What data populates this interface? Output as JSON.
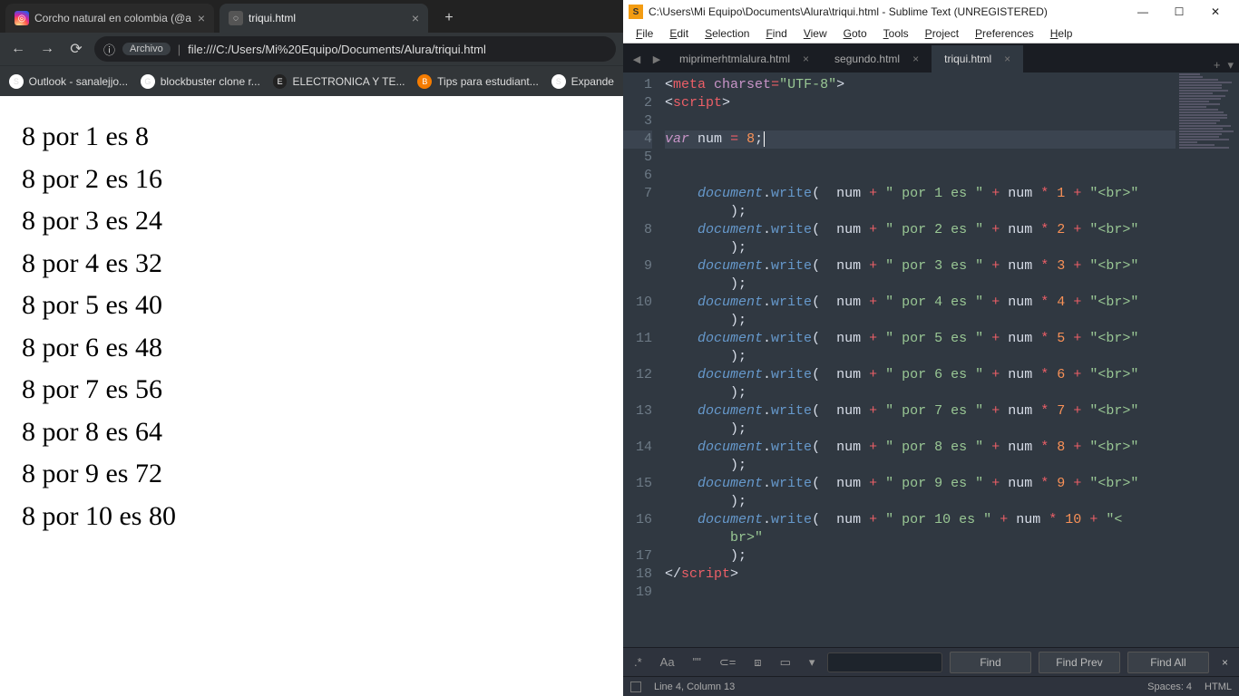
{
  "browser": {
    "tabs": [
      {
        "title": "Corcho natural en colombia (@a",
        "favicon": "ig"
      },
      {
        "title": "triqui.html",
        "favicon": "file"
      }
    ],
    "new_tab": "+",
    "nav": {
      "back": "←",
      "fwd": "→",
      "reload": "⟳",
      "chip_icon": "ⓘ",
      "chip_label": "Archivo",
      "url": "file:///C:/Users/Mi%20Equipo/Documents/Alura/triqui.html"
    },
    "bookmarks": [
      {
        "icon": "S",
        "label": "Outlook - sanalejjo..."
      },
      {
        "icon": "G",
        "label": "blockbuster clone r..."
      },
      {
        "icon": "E",
        "label": "ELECTRONICA Y TE..."
      },
      {
        "icon": "B",
        "label": "Tips para estudiant..."
      },
      {
        "icon": "S",
        "label": "Expande"
      }
    ],
    "page_lines": [
      "8 por 1 es 8",
      "8 por 2 es 16",
      "8 por 3 es 24",
      "8 por 4 es 32",
      "8 por 5 es 40",
      "8 por 6 es 48",
      "8 por 7 es 56",
      "8 por 8 es 64",
      "8 por 9 es 72",
      "8 por 10 es 80"
    ]
  },
  "sublime": {
    "title": "C:\\Users\\Mi Equipo\\Documents\\Alura\\triqui.html - Sublime Text (UNREGISTERED)",
    "win_btns": {
      "min": "—",
      "max": "☐",
      "close": "✕"
    },
    "menu": [
      "File",
      "Edit",
      "Selection",
      "Find",
      "View",
      "Goto",
      "Tools",
      "Project",
      "Preferences",
      "Help"
    ],
    "file_tabs": [
      "miprimerhtmlalura.html",
      "segundo.html",
      "triqui.html"
    ],
    "active_tab": 2,
    "gutter": [
      "1",
      "2",
      "3",
      "4",
      "5",
      "6",
      "7",
      "",
      "8",
      "",
      "9",
      "",
      "10",
      "",
      "11",
      "",
      "12",
      "",
      "13",
      "",
      "14",
      "",
      "15",
      "",
      "16",
      "",
      "17",
      "18",
      "19"
    ],
    "find": {
      "modes": [
        ".*",
        "Aa",
        "\"\"",
        "⊂=",
        "⧈",
        "▭"
      ],
      "btn_find": "Find",
      "btn_prev": "Find Prev",
      "btn_all": "Find All"
    },
    "status": {
      "pos": "Line 4, Column 13",
      "spaces": "Spaces: 4",
      "lang": "HTML"
    }
  },
  "code": {
    "num_var": "8",
    "lines": [
      {
        "n": 1,
        "raw": "meta_line"
      },
      {
        "n": 2,
        "raw": "script_open"
      },
      {
        "n": 3,
        "raw": "blank"
      },
      {
        "n": 4,
        "raw": "var_line"
      },
      {
        "n": 5,
        "raw": "blank"
      },
      {
        "n": 6,
        "raw": "blank"
      },
      {
        "n": 7,
        "mult": "1"
      },
      {
        "n": 8,
        "mult": "2"
      },
      {
        "n": 9,
        "mult": "3"
      },
      {
        "n": 10,
        "mult": "4"
      },
      {
        "n": 11,
        "mult": "5"
      },
      {
        "n": 12,
        "mult": "6"
      },
      {
        "n": 13,
        "mult": "7"
      },
      {
        "n": 14,
        "mult": "8"
      },
      {
        "n": 15,
        "mult": "9"
      },
      {
        "n": 16,
        "mult": "10",
        "last": true
      },
      {
        "n": 17,
        "raw": "close_paren"
      },
      {
        "n": 18,
        "raw": "script_close"
      },
      {
        "n": 19,
        "raw": "blank"
      }
    ]
  }
}
